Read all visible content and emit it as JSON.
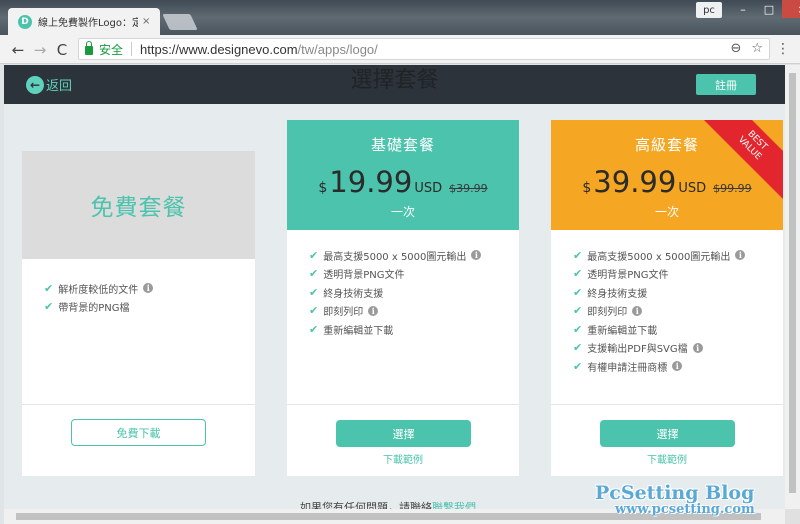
{
  "browser": {
    "tab_icon": "D",
    "tab_title": "線上免費製作Logo：定制",
    "tab_close": "×",
    "user_label": "pc",
    "window_controls": [
      "–",
      "□",
      "×"
    ],
    "nav": {
      "back": "←",
      "forward": "→",
      "reload": "C"
    },
    "secure_label": "安全",
    "url_main": "https://www.designevo.com",
    "url_path": "/tw/apps/logo/",
    "zoom_icon": "⊖",
    "star_icon": "☆",
    "menu_icon": "⋮"
  },
  "header": {
    "back_label": "返回",
    "title": "選擇套餐",
    "register_label": "註冊"
  },
  "plans": {
    "free": {
      "name": "免費套餐",
      "features": [
        "解析度較低的文件",
        "帶背景的PNG檔"
      ],
      "feature_info": [
        true,
        false
      ],
      "button": "免費下載"
    },
    "basic": {
      "name": "基礎套餐",
      "currency": "$",
      "price": "19.99",
      "unit": "USD",
      "old_price": "$39.99",
      "period": "一次",
      "features": [
        "最高支援5000 x 5000圖元輸出",
        "透明背景PNG文件",
        "終身技術支援",
        "即刻列印",
        "重新編輯並下載"
      ],
      "feature_info": [
        true,
        false,
        false,
        true,
        false
      ],
      "button": "選擇",
      "sample": "下載範例"
    },
    "premium": {
      "name": "高級套餐",
      "currency": "$",
      "price": "39.99",
      "unit": "USD",
      "old_price": "$99.99",
      "period": "一次",
      "ribbon_line1": "BEST",
      "ribbon_line2": "VALUE",
      "features": [
        "最高支援5000 x 5000圖元輸出",
        "透明背景PNG文件",
        "終身技術支援",
        "即刻列印",
        "重新編輯並下載",
        "支援輸出PDF與SVG檔",
        "有權申請注冊商標"
      ],
      "feature_info": [
        true,
        false,
        false,
        true,
        false,
        true,
        true
      ],
      "button": "選擇",
      "sample": "下載範例"
    }
  },
  "footer": {
    "question": "如果您有任何問題，請聯絡",
    "link": "聯繫我們"
  },
  "watermark": {
    "title": "PcSetting Blog",
    "url": "www.pcsetting.com"
  },
  "colors": {
    "accent": "#4cc3ad",
    "premium": "#f5a623",
    "ribbon": "#e3262d",
    "header_bg": "#2d333a"
  }
}
